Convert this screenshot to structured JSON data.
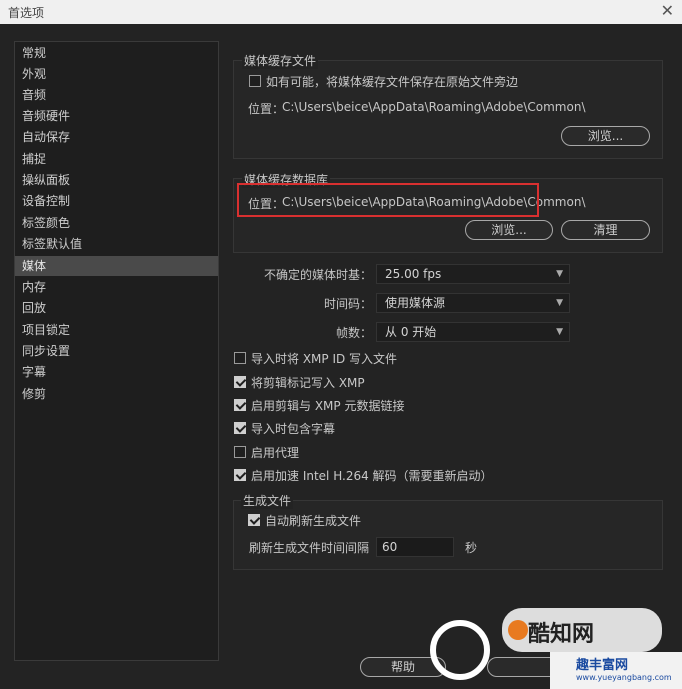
{
  "window": {
    "title": "首选项",
    "close_glyph": "✕"
  },
  "sidebar": {
    "items": [
      {
        "label": "常规"
      },
      {
        "label": "外观"
      },
      {
        "label": "音频"
      },
      {
        "label": "音频硬件"
      },
      {
        "label": "自动保存"
      },
      {
        "label": "捕捉"
      },
      {
        "label": "操纵面板"
      },
      {
        "label": "设备控制"
      },
      {
        "label": "标签颜色"
      },
      {
        "label": "标签默认值"
      },
      {
        "label": "媒体",
        "selected": true
      },
      {
        "label": "内存"
      },
      {
        "label": "回放"
      },
      {
        "label": "项目锁定"
      },
      {
        "label": "同步设置"
      },
      {
        "label": "字幕"
      },
      {
        "label": "修剪"
      }
    ]
  },
  "media_cache_files": {
    "title": "媒体缓存文件",
    "save_next_to_original_label": "如有可能，将媒体缓存文件保存在原始文件旁边",
    "save_next_to_original_checked": false,
    "location_label": "位置：",
    "location_path": "C:\\Users\\beice\\AppData\\Roaming\\Adobe\\Common\\",
    "browse_label": "浏览..."
  },
  "media_cache_db": {
    "title": "媒体缓存数据库",
    "location_label": "位置：",
    "location_path": "C:\\Users\\beice\\AppData\\Roaming\\Adobe\\Common\\",
    "browse_label": "浏览...",
    "clean_label": "清理"
  },
  "settings": {
    "timebase_label": "不确定的媒体时基：",
    "timebase_value": "25.00 fps",
    "timecode_label": "时间码：",
    "timecode_value": "使用媒体源",
    "frame_label": "帧数：",
    "frame_value": "从 0 开始"
  },
  "checkboxes": [
    {
      "label": "导入时将 XMP ID 写入文件",
      "checked": false
    },
    {
      "label": "将剪辑标记写入 XMP",
      "checked": true
    },
    {
      "label": "启用剪辑与 XMP 元数据链接",
      "checked": true
    },
    {
      "label": "导入时包含字幕",
      "checked": true
    },
    {
      "label": "启用代理",
      "checked": false
    },
    {
      "label": "启用加速 Intel H.264 解码（需要重新启动）",
      "checked": true
    }
  ],
  "growing_files": {
    "title": "生成文件",
    "auto_refresh_label": "自动刷新生成文件",
    "auto_refresh_checked": true,
    "interval_label": "刷新生成文件时间间隔",
    "interval_value": "60",
    "interval_unit": "秒"
  },
  "footer": {
    "help_label": "帮助"
  },
  "watermark": {
    "text1": "酷知网",
    "text2": "趣丰富网",
    "text3": "www.yueyangbang.com"
  },
  "colors": {
    "highlight": "#d93030",
    "background": "#232323",
    "selected": "#4a4a4a"
  }
}
